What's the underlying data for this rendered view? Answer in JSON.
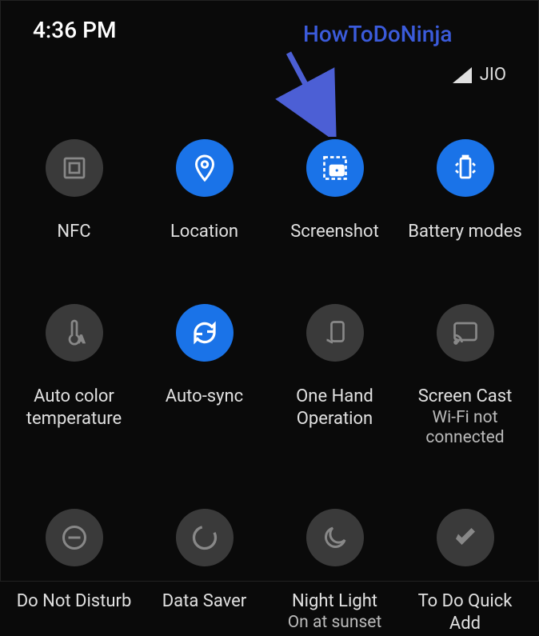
{
  "status": {
    "time": "4:36 PM",
    "carrier": "JIO"
  },
  "watermark": "HowToDoNinja",
  "tiles": [
    {
      "name": "nfc-tile",
      "icon": "nfc-icon",
      "active": false,
      "label": "NFC",
      "sublabel": ""
    },
    {
      "name": "location-tile",
      "icon": "location-icon",
      "active": true,
      "label": "Location",
      "sublabel": ""
    },
    {
      "name": "screenshot-tile",
      "icon": "screenshot-icon",
      "active": true,
      "label": "Screenshot",
      "sublabel": ""
    },
    {
      "name": "battery-modes-tile",
      "icon": "battery-icon",
      "active": true,
      "label": "Battery modes",
      "sublabel": ""
    },
    {
      "name": "auto-color-temperature-tile",
      "icon": "temperature-icon",
      "active": false,
      "label": "Auto color temperature",
      "sublabel": ""
    },
    {
      "name": "auto-sync-tile",
      "icon": "sync-icon",
      "active": true,
      "label": "Auto-sync",
      "sublabel": ""
    },
    {
      "name": "one-hand-operation-tile",
      "icon": "one-hand-icon",
      "active": false,
      "label": "One Hand Operation",
      "sublabel": ""
    },
    {
      "name": "screen-cast-tile",
      "icon": "cast-icon",
      "active": false,
      "label": "Screen Cast",
      "sublabel": "Wi-Fi not connected"
    },
    {
      "name": "do-not-disturb-tile",
      "icon": "dnd-icon",
      "active": false,
      "label": "Do Not Disturb",
      "sublabel": ""
    },
    {
      "name": "data-saver-tile",
      "icon": "data-saver-icon",
      "active": false,
      "label": "Data Saver",
      "sublabel": ""
    },
    {
      "name": "night-light-tile",
      "icon": "moon-icon",
      "active": false,
      "label": "Night Light",
      "sublabel": "On at sunset"
    },
    {
      "name": "todo-quick-add-tile",
      "icon": "check-icon",
      "active": false,
      "label": "To Do Quick Add",
      "sublabel": ""
    }
  ]
}
